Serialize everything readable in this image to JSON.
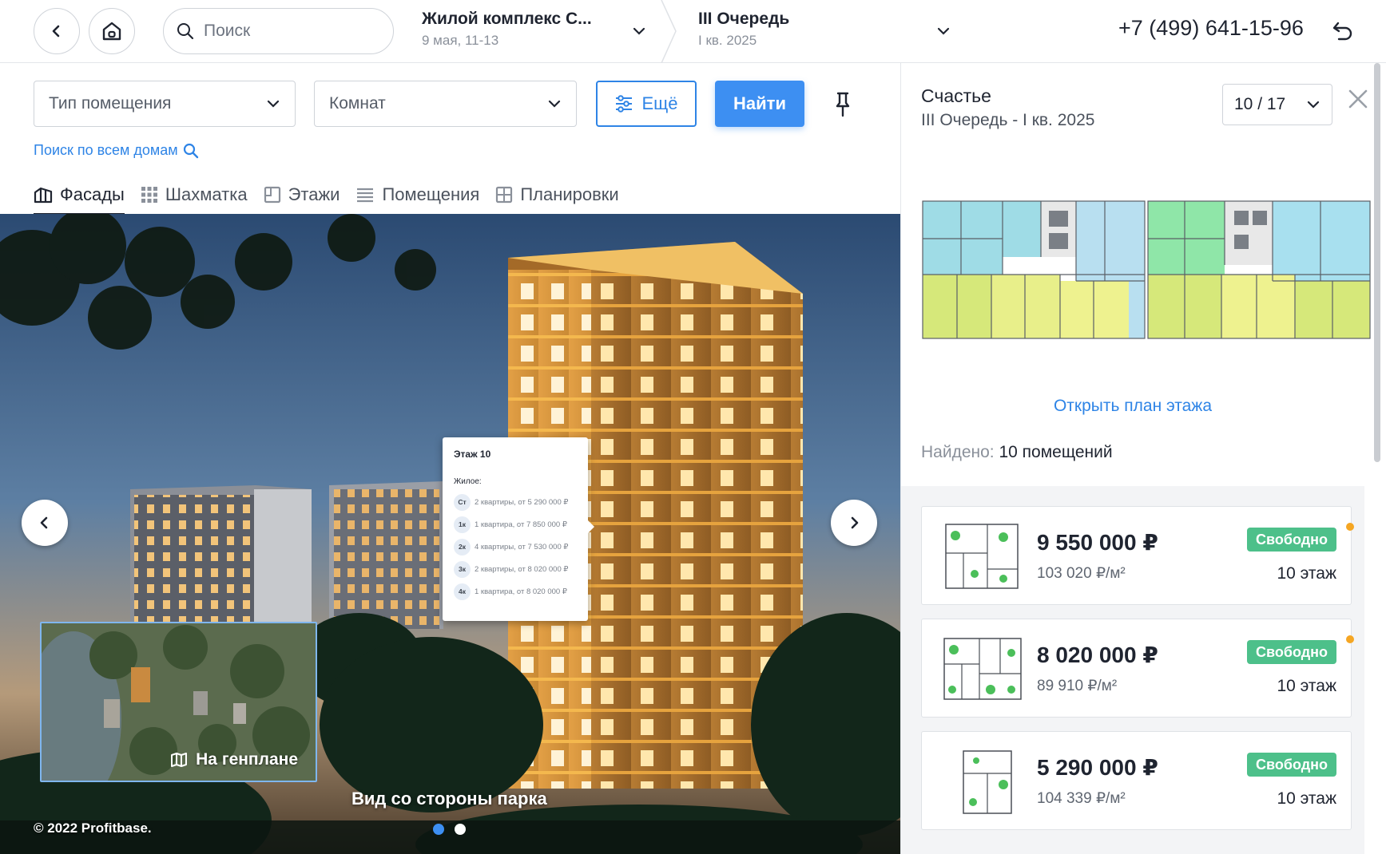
{
  "header": {
    "search_placeholder": "Поиск",
    "complex_title": "Жилой комплекс С...",
    "complex_sub": "9 мая, 11-13",
    "queue_title": "III Очередь",
    "queue_sub": "I кв. 2025",
    "phone": "+7 (499) 641-15-96"
  },
  "filters": {
    "type_label": "Тип помещения",
    "rooms_label": "Комнат",
    "more_label": "Ещё",
    "find_label": "Найти",
    "search_all_label": "Поиск по всем домам"
  },
  "tabs": [
    {
      "label": "Фасады",
      "icon": "facade-icon"
    },
    {
      "label": "Шахматка",
      "icon": "grid-icon"
    },
    {
      "label": "Этажи",
      "icon": "floors-icon"
    },
    {
      "label": "Помещения",
      "icon": "list-icon"
    },
    {
      "label": "Планировки",
      "icon": "layout-icon"
    }
  ],
  "hero": {
    "popup": {
      "title": "Этаж 10",
      "section": "Жилое:",
      "rows": [
        {
          "badge": "Ст",
          "text": "2 квартиры, от 5 290 000 ₽"
        },
        {
          "badge": "1к",
          "text": "1 квартира, от 7 850 000 ₽"
        },
        {
          "badge": "2к",
          "text": "4 квартиры, от 7 530 000 ₽"
        },
        {
          "badge": "3к",
          "text": "2 квартиры, от 8 020 000 ₽"
        },
        {
          "badge": "4к",
          "text": "1 квартира, от 8 020 000 ₽"
        }
      ]
    },
    "genplan_label": "На генплане",
    "caption": "Вид со стороны парка",
    "copyright": "© 2022 Profitbase."
  },
  "panel": {
    "title": "Счастье",
    "subtitle": "III Очередь - I кв. 2025",
    "floor_select": "10 / 17",
    "open_plan": "Открыть план этажа",
    "found_label": "Найдено:",
    "found_value": "10 помещений",
    "cards": [
      {
        "price": "9 550 000 ₽",
        "ppm": "103 020 ₽/м²",
        "status": "Свободно",
        "floor": "10 этаж"
      },
      {
        "price": "8 020 000 ₽",
        "ppm": "89 910 ₽/м²",
        "status": "Свободно",
        "floor": "10 этаж"
      },
      {
        "price": "5 290 000 ₽",
        "ppm": "104 339 ₽/м²",
        "status": "Свободно",
        "floor": "10 этаж"
      }
    ],
    "colors": {
      "accent": "#2e84e6",
      "status": "#4dc08a",
      "new_dot": "#f5a623"
    }
  }
}
